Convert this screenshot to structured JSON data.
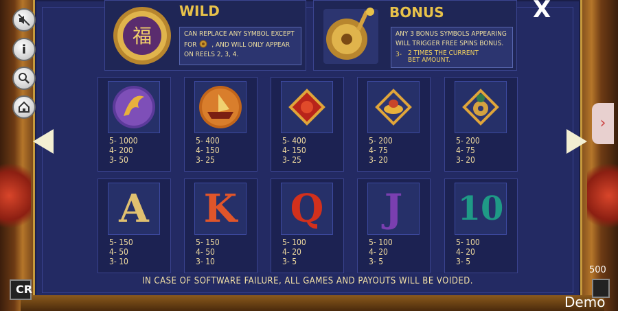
{
  "close_glyph": "X",
  "nav": {
    "prev_glyph": "◀",
    "next_glyph": "▶",
    "side_tab_glyph": "›"
  },
  "side_buttons": [
    {
      "icon": "sound-off-icon"
    },
    {
      "icon": "info-icon",
      "glyph": "i"
    },
    {
      "icon": "zoom-icon"
    },
    {
      "icon": "home-icon"
    }
  ],
  "wild": {
    "title": "WILD",
    "line1": "CAN REPLACE ANY SYMBOL EXCEPT",
    "line2a": "FOR",
    "line2b": ", AND WILL ONLY APPEAR",
    "line3": "ON REELS 2, 3, 4.",
    "emblem_char": "福"
  },
  "bonus": {
    "title": "BONUS",
    "line1": "ANY 3 BONUS SYMBOLS APPEARING",
    "line2": "WILL TRIGGER FREE SPINS BONUS.",
    "pay_count": "3-",
    "pay_text1": "2 TIMES THE CURRENT",
    "pay_text2": "BET AMOUNT."
  },
  "paytable_row1": [
    {
      "symbol": "phoenix",
      "pays": [
        "5-  1000",
        "4-  200",
        "3-  50"
      ]
    },
    {
      "symbol": "ship",
      "pays": [
        "5-  400",
        "4-  150",
        "3-  25"
      ]
    },
    {
      "symbol": "red-lantern",
      "pays": [
        "5-  400",
        "4-  150",
        "3-  25"
      ]
    },
    {
      "symbol": "gold-ingot",
      "pays": [
        "5-  200",
        "4-  75",
        "3-  20"
      ]
    },
    {
      "symbol": "jade-coin",
      "pays": [
        "5-  200",
        "4-  75",
        "3-  20"
      ]
    }
  ],
  "paytable_row2": [
    {
      "symbol": "A",
      "color": "#e0c070",
      "pays": [
        "5-  150",
        "4-  50",
        "3-  10"
      ]
    },
    {
      "symbol": "K",
      "color": "#e0552a",
      "pays": [
        "5-  150",
        "4-  50",
        "3-  10"
      ]
    },
    {
      "symbol": "Q",
      "color": "#d2301c",
      "pays": [
        "5-  100",
        "4-  20",
        "3-  5"
      ]
    },
    {
      "symbol": "J",
      "color": "#7a3fb0",
      "pays": [
        "5-  100",
        "4-  20",
        "3-  5"
      ]
    },
    {
      "symbol": "10",
      "color": "#1f9a86",
      "pays": [
        "5-  100",
        "4-  20",
        "3-  5"
      ]
    }
  ],
  "footer_note": "IN CASE OF SOFTWARE FAILURE, ALL GAMES AND PAYOUTS WILL BE VOIDED.",
  "bottom": {
    "cr_label": "CR",
    "bet_value": "500",
    "demo_label": "Demo"
  }
}
